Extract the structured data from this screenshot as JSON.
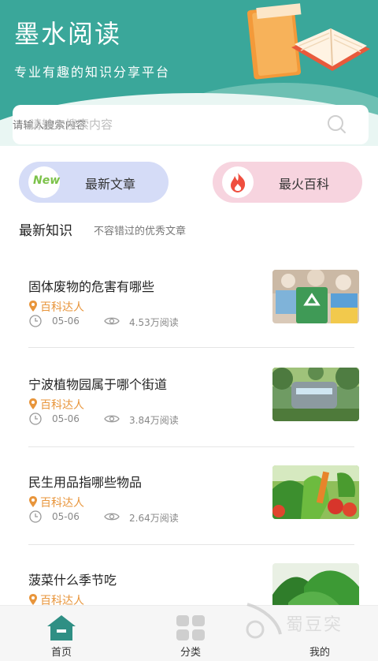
{
  "header": {
    "title": "墨水阅读",
    "subtitle": "专业有趣的知识分享平台",
    "background_color": "#3aa79a"
  },
  "search": {
    "placeholder": "请输入搜索内容",
    "icon": "search-icon"
  },
  "quick_links": [
    {
      "label": "最新文章",
      "badge_text": "New",
      "icon": "new-badge-icon",
      "color": "#d5dcf7"
    },
    {
      "label": "最火百科",
      "icon": "fire-icon",
      "color": "#f7d4df"
    }
  ],
  "section": {
    "title": "最新知识",
    "subtitle": "不容错过的优秀文章"
  },
  "articles": [
    {
      "title": "固体废物的危害有哪些",
      "author": "百科达人",
      "date": "05-06",
      "views": "4.53万阅读",
      "thumb": "recycling-image"
    },
    {
      "title": "宁波植物园属于哪个街道",
      "author": "百科达人",
      "date": "05-06",
      "views": "3.84万阅读",
      "thumb": "park-stone-image"
    },
    {
      "title": "民生用品指哪些物品",
      "author": "百科达人",
      "date": "05-06",
      "views": "2.64万阅读",
      "thumb": "vegetables-image"
    },
    {
      "title": "菠菜什么季节吃",
      "author": "百科达人",
      "thumb": "spinach-image"
    }
  ],
  "tabbar": {
    "items": [
      {
        "label": "首页",
        "icon": "home-icon",
        "active": true
      },
      {
        "label": "分类",
        "icon": "grid-icon",
        "active": false
      },
      {
        "label": "我的",
        "icon": "user-icon",
        "active": false
      }
    ]
  },
  "watermark": {
    "text": "蜀豆突"
  },
  "colors": {
    "accent": "#3aa79a",
    "author": "#e8953b"
  }
}
